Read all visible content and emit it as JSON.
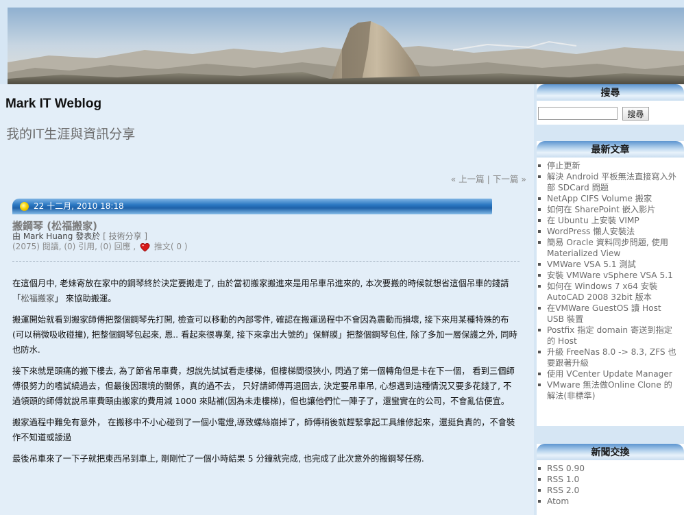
{
  "blog": {
    "title": "Mark IT Weblog",
    "subtitle": "我的IT生涯與資訊分享"
  },
  "post_nav": {
    "prev": "« 上一篇",
    "separator": "|",
    "next": "下一篇 »"
  },
  "post": {
    "date": "22 十二月, 2010 18:18",
    "title": "搬鋼琴 (松福搬家)",
    "author_line": "由 Mark Huang 發表於",
    "category": "[ 技術分享 ]",
    "stats": "(2075) 閱讀, (0) 引用, (0) 回應 ,",
    "push_label": "推文( 0 )",
    "paragraphs": [
      "在這個月中, 老妹寄放在家中的鋼琴終於決定要搬走了, 由於當初搬家搬進來是用吊車吊進來的, 本次要搬的時候就想省這個吊車的錢請 「",
      "搬運開始就看到搬家師傅把整個鋼琴先打開, 檢查可以移動的內部零件, 確認在搬運過程中不會因為震動而損壞, 接下來用某種特殊的布(可以稍微吸收碰撞), 把整個鋼琴包起來, 恩.. 看起來很專業, 接下來拿出大號的」保鮮膜」把整個鋼琴包住, 除了多加一層保護之外, 同時也防水.",
      "接下來就是頭痛的搬下樓去, 為了節省吊車費，想說先試試看走樓梯，但樓梯間很狹小, 閃過了第一個轉角但是卡在下一個， 看到三個師傅很努力的嗜試繞過去，但最後因環境的關係，真的過不去， 只好請師傅再退回去, 決定要吊車吊, 心想遇到這種情況又要多花錢了, 不過領頭的師傅就說吊車費頤由搬家的費用減 1000 來貼補(因為未走樓梯)，但也讓他們忙一陣子了，還蠻實在的公司，不會亂估便宜。",
      "搬家過程中難免有意外， 在搬移中不小心碰到了一個小電燈,導致螺絲崩掉了，師傅稍後就趕緊拿起工具維修起來，還挺負責的，不會裝作不知道或諉過",
      " 最後吊車來了一下子就把東西吊到車上, 剛剛忙了一個小時結果 5 分鐘就完成, 也完成了此次意外的搬鋼琴任務."
    ],
    "p1_link": "松福搬家",
    "p1_tail": "」 來協助搬運。"
  },
  "sidebar": {
    "search": {
      "heading": "搜尋",
      "button": "搜尋",
      "value": ""
    },
    "recent": {
      "heading": "最新文章",
      "items": [
        "停止更新",
        "解決 Android 平板無法直接寫入外部 SDCard 問題",
        "NetApp CIFS Volume 搬家",
        "如何在 SharePoint 嵌入影片",
        "在 Ubuntu 上安裝 VIMP",
        "WordPress 懶人安裝法",
        "簡易 Oracle 資料同步問題, 使用 Materialized View",
        "VMWare VSA 5.1 測試",
        "安裝 VMWare vSphere VSA 5.1",
        "如何在 Windows 7 x64 安裝 AutoCAD 2008 32bit 版本",
        "在VMWare GuestOS 讀 Host USB 裝置",
        "Postfix 指定 domain 寄送到指定的 Host",
        "升級 FreeNas 8.0 -> 8.3, ZFS 也要跟著升級",
        "使用 VCenter Update Manager",
        "VMware 無法做Online Clone 的解法(非標準)"
      ]
    },
    "feeds": {
      "heading": "新聞交換",
      "items": [
        "RSS 0.90",
        "RSS 1.0",
        "RSS 2.0",
        "Atom"
      ]
    }
  },
  "colors": {
    "page_bg": "#d6e6f4",
    "content_bg": "#e3eef8",
    "date_bar": "#1e61a8"
  }
}
